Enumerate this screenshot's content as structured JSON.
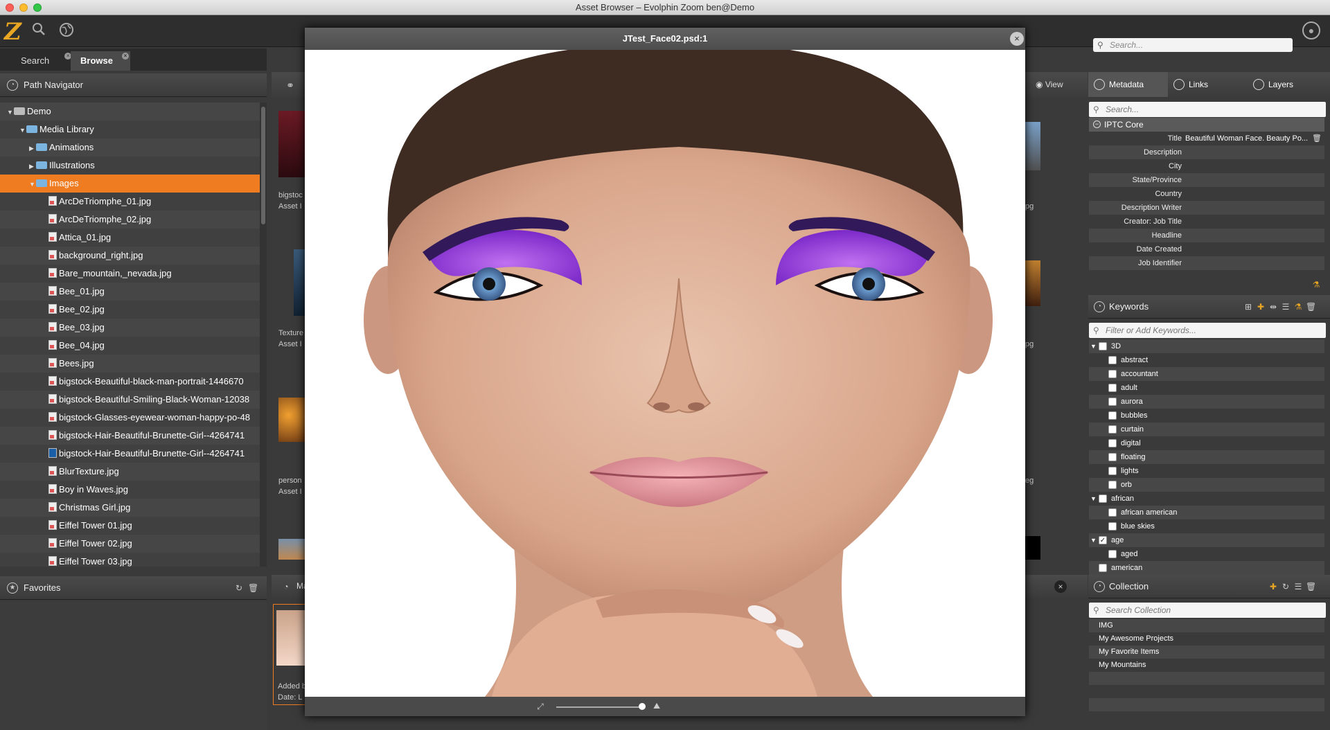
{
  "window": {
    "title": "Asset Browser – Evolphin Zoom ben@Demo"
  },
  "toolbar": {
    "search_placeholder": "Search..."
  },
  "tabs": [
    {
      "label": "Search"
    },
    {
      "label": "Browse"
    }
  ],
  "path_navigator": {
    "title": "Path Navigator",
    "items": [
      {
        "label": "Demo"
      },
      {
        "label": "Media Library"
      },
      {
        "label": "Animations"
      },
      {
        "label": "Illustrations"
      },
      {
        "label": "Images"
      },
      {
        "label": "ArcDeTriomphe_01.jpg"
      },
      {
        "label": "ArcDeTriomphe_02.jpg"
      },
      {
        "label": "Attica_01.jpg"
      },
      {
        "label": "background_right.jpg"
      },
      {
        "label": "Bare_mountain,_nevada.jpg"
      },
      {
        "label": "Bee_01.jpg"
      },
      {
        "label": "Bee_02.jpg"
      },
      {
        "label": "Bee_03.jpg"
      },
      {
        "label": "Bee_04.jpg"
      },
      {
        "label": "Bees.jpg"
      },
      {
        "label": "bigstock-Beautiful-black-man-portrait-1446670"
      },
      {
        "label": "bigstock-Beautiful-Smiling-Black-Woman-12038"
      },
      {
        "label": "bigstock-Glasses-eyewear-woman-happy-po-48"
      },
      {
        "label": "bigstock-Hair-Beautiful-Brunette-Girl--4264741"
      },
      {
        "label": "bigstock-Hair-Beautiful-Brunette-Girl--4264741"
      },
      {
        "label": "BlurTexture.jpg"
      },
      {
        "label": "Boy in Waves.jpg"
      },
      {
        "label": "Christmas Girl.jpg"
      },
      {
        "label": "Eiffel Tower 01.jpg"
      },
      {
        "label": "Eiffel Tower 02.jpg"
      },
      {
        "label": "Eiffel Tower 03.jpg"
      }
    ]
  },
  "favorites": {
    "title": "Favorites"
  },
  "center": {
    "view_label": "View",
    "thumb_texts": [
      "bigstoc",
      "Asset I",
      "Texture",
      "Asset I",
      "person",
      "Asset I"
    ],
    "right_texts": [
      "pg",
      "pg",
      "eg"
    ],
    "bottom_tab": "Ma",
    "bottom_texts": [
      "Added b",
      "Date: L"
    ]
  },
  "viewer": {
    "title": "JTest_Face02.psd:1"
  },
  "metadata": {
    "tabs": [
      {
        "label": "Metadata"
      },
      {
        "label": "Links"
      },
      {
        "label": "Layers"
      }
    ],
    "search_placeholder": "Search...",
    "section": "IPTC Core",
    "fields": [
      {
        "label": "Title",
        "value": "Beautiful Woman Face. Beauty Po..."
      },
      {
        "label": "Description",
        "value": ""
      },
      {
        "label": "City",
        "value": ""
      },
      {
        "label": "State/Province",
        "value": ""
      },
      {
        "label": "Country",
        "value": ""
      },
      {
        "label": "Description Writer",
        "value": ""
      },
      {
        "label": "Creator: Job Title",
        "value": ""
      },
      {
        "label": "Headline",
        "value": ""
      },
      {
        "label": "Date Created",
        "value": ""
      },
      {
        "label": "Job Identifier",
        "value": ""
      }
    ]
  },
  "keywords": {
    "title": "Keywords",
    "filter_placeholder": "Filter or Add Keywords...",
    "items": [
      {
        "label": "3D",
        "checked": false
      },
      {
        "label": "abstract",
        "checked": false
      },
      {
        "label": "accountant",
        "checked": false
      },
      {
        "label": "adult",
        "checked": false
      },
      {
        "label": "aurora",
        "checked": false
      },
      {
        "label": "bubbles",
        "checked": false
      },
      {
        "label": "curtain",
        "checked": false
      },
      {
        "label": "digital",
        "checked": false
      },
      {
        "label": "floating",
        "checked": false
      },
      {
        "label": "lights",
        "checked": false
      },
      {
        "label": "orb",
        "checked": false
      },
      {
        "label": "african",
        "checked": false
      },
      {
        "label": "african american",
        "checked": false
      },
      {
        "label": "blue skies",
        "checked": false
      },
      {
        "label": "age",
        "checked": true
      },
      {
        "label": "aged",
        "checked": false
      },
      {
        "label": "american",
        "checked": false
      }
    ]
  },
  "collection": {
    "title": "Collection",
    "search_placeholder": "Search Collection",
    "items": [
      {
        "label": "IMG"
      },
      {
        "label": "My Awesome Projects"
      },
      {
        "label": "My Favorite Items"
      },
      {
        "label": "My Mountains"
      }
    ]
  },
  "colors": {
    "accent": "#f07c22",
    "brand": "#e8a623"
  }
}
